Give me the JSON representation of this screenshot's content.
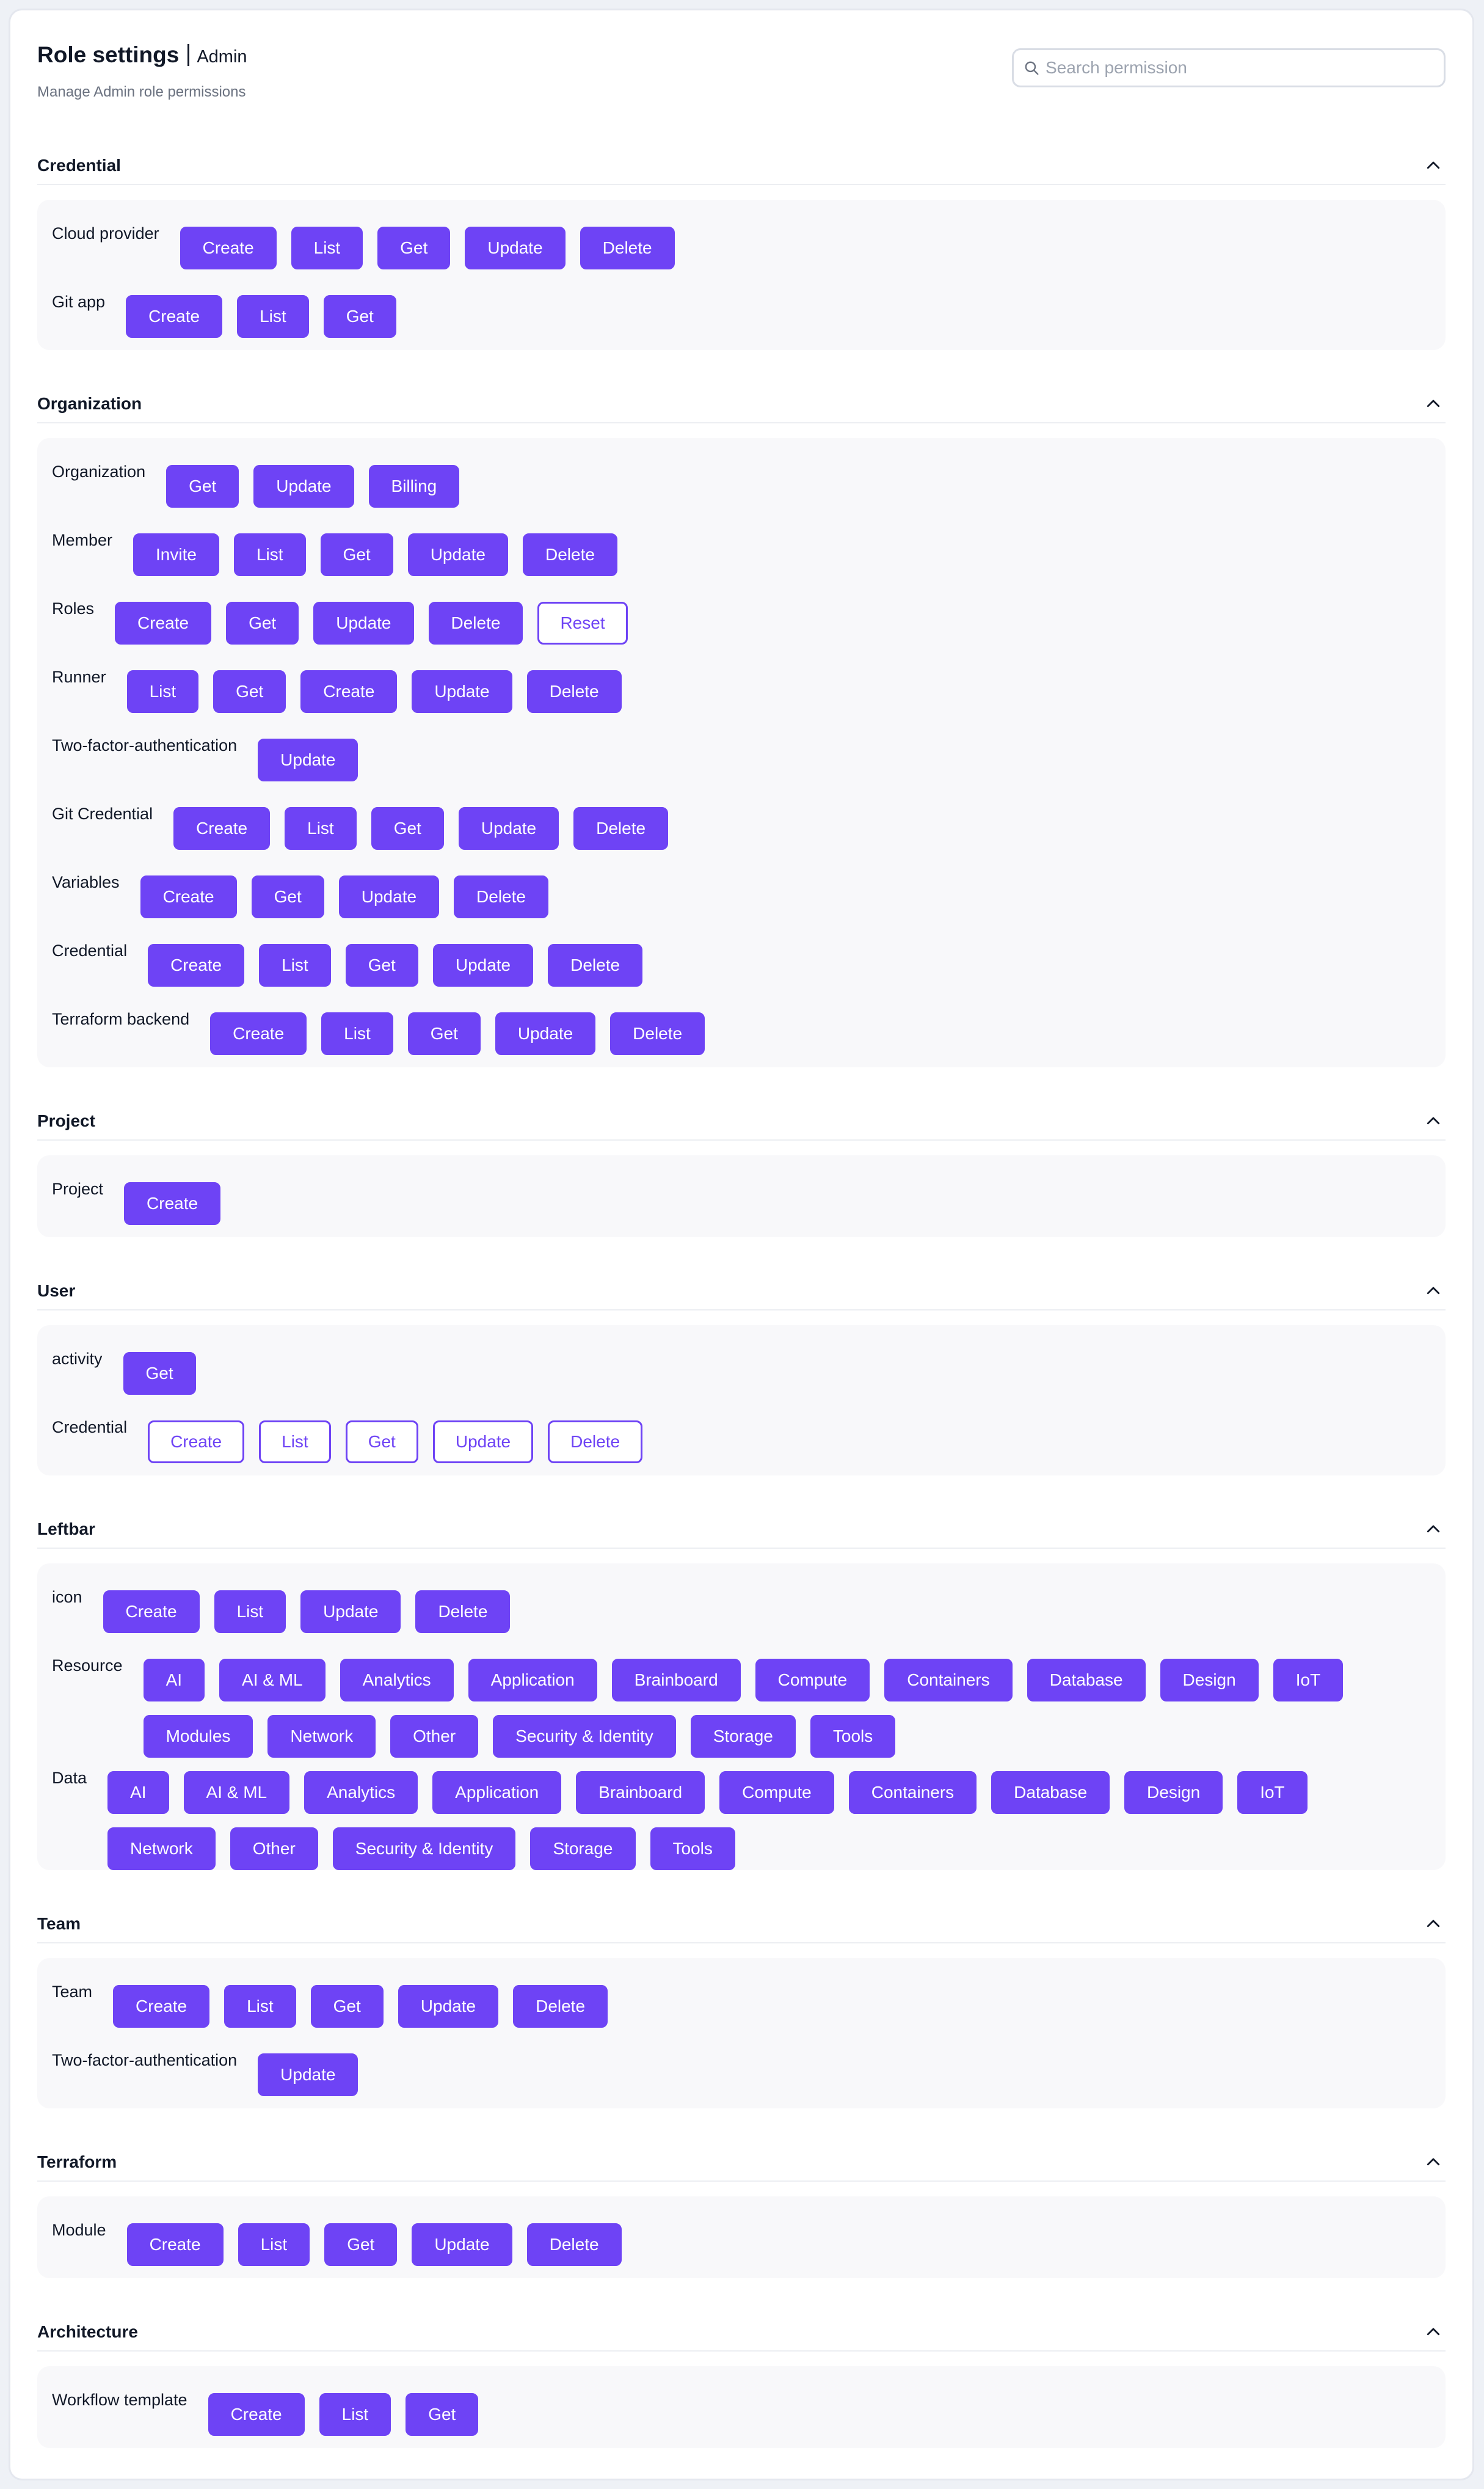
{
  "header": {
    "title": "Role settings",
    "role": "Admin",
    "subtitle": "Manage Admin role permissions"
  },
  "search": {
    "placeholder": "Search permission",
    "icon": "search-icon"
  },
  "colors": {
    "accent": "#6e43f5",
    "card_bg": "#f8f8fa",
    "border": "#d9dde5"
  },
  "sections": [
    {
      "title": "Credential",
      "rows": [
        {
          "label": "Cloud provider",
          "perms": [
            {
              "label": "Create",
              "on": true
            },
            {
              "label": "List",
              "on": true
            },
            {
              "label": "Get",
              "on": true
            },
            {
              "label": "Update",
              "on": true
            },
            {
              "label": "Delete",
              "on": true
            }
          ]
        },
        {
          "label": "Git app",
          "perms": [
            {
              "label": "Create",
              "on": true
            },
            {
              "label": "List",
              "on": true
            },
            {
              "label": "Get",
              "on": true
            }
          ]
        }
      ]
    },
    {
      "title": "Organization",
      "rows": [
        {
          "label": "Organization",
          "perms": [
            {
              "label": "Get",
              "on": true
            },
            {
              "label": "Update",
              "on": true
            },
            {
              "label": "Billing",
              "on": true
            }
          ]
        },
        {
          "label": "Member",
          "perms": [
            {
              "label": "Invite",
              "on": true
            },
            {
              "label": "List",
              "on": true
            },
            {
              "label": "Get",
              "on": true
            },
            {
              "label": "Update",
              "on": true
            },
            {
              "label": "Delete",
              "on": true
            }
          ]
        },
        {
          "label": "Roles",
          "perms": [
            {
              "label": "Create",
              "on": true
            },
            {
              "label": "Get",
              "on": true
            },
            {
              "label": "Update",
              "on": true
            },
            {
              "label": "Delete",
              "on": true
            },
            {
              "label": "Reset",
              "on": false
            }
          ]
        },
        {
          "label": "Runner",
          "perms": [
            {
              "label": "List",
              "on": true
            },
            {
              "label": "Get",
              "on": true
            },
            {
              "label": "Create",
              "on": true
            },
            {
              "label": "Update",
              "on": true
            },
            {
              "label": "Delete",
              "on": true
            }
          ]
        },
        {
          "label": "Two-factor-authentication",
          "perms": [
            {
              "label": "Update",
              "on": true
            }
          ]
        },
        {
          "label": "Git Credential",
          "perms": [
            {
              "label": "Create",
              "on": true
            },
            {
              "label": "List",
              "on": true
            },
            {
              "label": "Get",
              "on": true
            },
            {
              "label": "Update",
              "on": true
            },
            {
              "label": "Delete",
              "on": true
            }
          ]
        },
        {
          "label": "Variables",
          "perms": [
            {
              "label": "Create",
              "on": true
            },
            {
              "label": "Get",
              "on": true
            },
            {
              "label": "Update",
              "on": true
            },
            {
              "label": "Delete",
              "on": true
            }
          ]
        },
        {
          "label": "Credential",
          "perms": [
            {
              "label": "Create",
              "on": true
            },
            {
              "label": "List",
              "on": true
            },
            {
              "label": "Get",
              "on": true
            },
            {
              "label": "Update",
              "on": true
            },
            {
              "label": "Delete",
              "on": true
            }
          ]
        },
        {
          "label": "Terraform backend",
          "perms": [
            {
              "label": "Create",
              "on": true
            },
            {
              "label": "List",
              "on": true
            },
            {
              "label": "Get",
              "on": true
            },
            {
              "label": "Update",
              "on": true
            },
            {
              "label": "Delete",
              "on": true
            }
          ]
        }
      ]
    },
    {
      "title": "Project",
      "rows": [
        {
          "label": "Project",
          "perms": [
            {
              "label": "Create",
              "on": true
            }
          ]
        }
      ]
    },
    {
      "title": "User",
      "rows": [
        {
          "label": "activity",
          "perms": [
            {
              "label": "Get",
              "on": true
            }
          ]
        },
        {
          "label": "Credential",
          "perms": [
            {
              "label": "Create",
              "on": false
            },
            {
              "label": "List",
              "on": false
            },
            {
              "label": "Get",
              "on": false
            },
            {
              "label": "Update",
              "on": false
            },
            {
              "label": "Delete",
              "on": false
            }
          ]
        }
      ]
    },
    {
      "title": "Leftbar",
      "rows": [
        {
          "label": "icon",
          "perms": [
            {
              "label": "Create",
              "on": true
            },
            {
              "label": "List",
              "on": true
            },
            {
              "label": "Update",
              "on": true
            },
            {
              "label": "Delete",
              "on": true
            }
          ]
        },
        {
          "label": "Resource",
          "perms": [
            {
              "label": "AI",
              "on": true
            },
            {
              "label": "AI & ML",
              "on": true
            },
            {
              "label": "Analytics",
              "on": true
            },
            {
              "label": "Application",
              "on": true
            },
            {
              "label": "Brainboard",
              "on": true
            },
            {
              "label": "Compute",
              "on": true
            },
            {
              "label": "Containers",
              "on": true
            },
            {
              "label": "Database",
              "on": true
            },
            {
              "label": "Design",
              "on": true
            },
            {
              "label": "IoT",
              "on": true
            },
            {
              "label": "Modules",
              "on": true
            },
            {
              "label": "Network",
              "on": true
            },
            {
              "label": "Other",
              "on": true
            },
            {
              "label": "Security & Identity",
              "on": true
            },
            {
              "label": "Storage",
              "on": true
            },
            {
              "label": "Tools",
              "on": true
            }
          ]
        },
        {
          "label": "Data",
          "perms": [
            {
              "label": "AI",
              "on": true
            },
            {
              "label": "AI & ML",
              "on": true
            },
            {
              "label": "Analytics",
              "on": true
            },
            {
              "label": "Application",
              "on": true
            },
            {
              "label": "Brainboard",
              "on": true
            },
            {
              "label": "Compute",
              "on": true
            },
            {
              "label": "Containers",
              "on": true
            },
            {
              "label": "Database",
              "on": true
            },
            {
              "label": "Design",
              "on": true
            },
            {
              "label": "IoT",
              "on": true
            },
            {
              "label": "Network",
              "on": true
            },
            {
              "label": "Other",
              "on": true
            },
            {
              "label": "Security & Identity",
              "on": true
            },
            {
              "label": "Storage",
              "on": true
            },
            {
              "label": "Tools",
              "on": true
            }
          ]
        }
      ]
    },
    {
      "title": "Team",
      "rows": [
        {
          "label": "Team",
          "perms": [
            {
              "label": "Create",
              "on": true
            },
            {
              "label": "List",
              "on": true
            },
            {
              "label": "Get",
              "on": true
            },
            {
              "label": "Update",
              "on": true
            },
            {
              "label": "Delete",
              "on": true
            }
          ]
        },
        {
          "label": "Two-factor-authentication",
          "perms": [
            {
              "label": "Update",
              "on": true
            }
          ]
        }
      ]
    },
    {
      "title": "Terraform",
      "rows": [
        {
          "label": "Module",
          "perms": [
            {
              "label": "Create",
              "on": true
            },
            {
              "label": "List",
              "on": true
            },
            {
              "label": "Get",
              "on": true
            },
            {
              "label": "Update",
              "on": true
            },
            {
              "label": "Delete",
              "on": true
            }
          ]
        }
      ]
    },
    {
      "title": "Architecture",
      "rows": [
        {
          "label": "Workflow template",
          "perms": [
            {
              "label": "Create",
              "on": true
            },
            {
              "label": "List",
              "on": true
            },
            {
              "label": "Get",
              "on": true
            }
          ]
        }
      ]
    }
  ]
}
